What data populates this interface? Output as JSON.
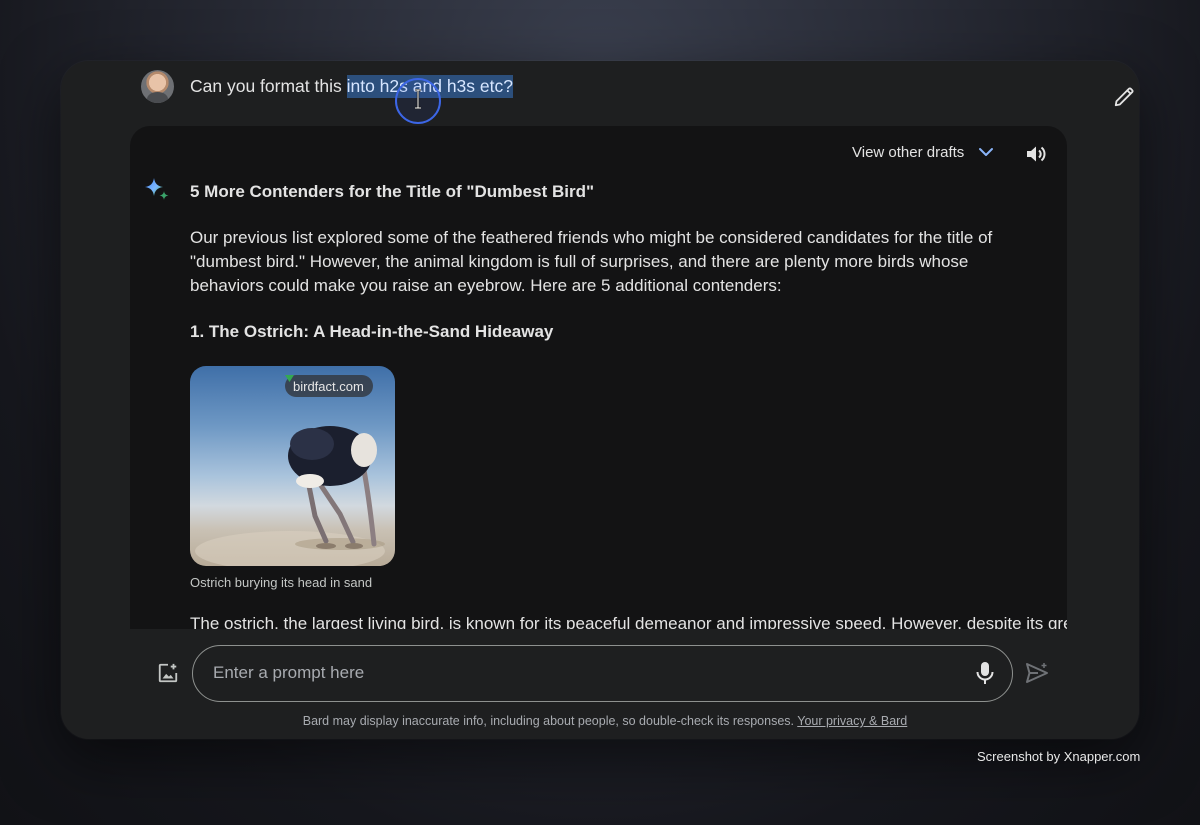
{
  "user_message": {
    "text_before": "Can you format this ",
    "text_selected": "into h2s and h3s etc?"
  },
  "response": {
    "drafts_label": "View other drafts",
    "title": "5 More Contenders for the Title of \"Dumbest Bird\"",
    "intro": "Our previous list explored some of the feathered friends who might be considered candidates for the title of \"dumbest bird.\" However, the animal kingdom is full of surprises, and there are plenty more birds whose behaviors could make you raise an eyebrow. Here are 5 additional contenders:",
    "section_heading": "1. The Ostrich: A Head-in-the-Sand Hideaway",
    "image": {
      "source": "birdfact.com",
      "caption": "Ostrich burying its head in sand"
    },
    "cutoff_text": "The ostrich, the largest living bird, is known for its peaceful demeanor and impressive speed. However, despite its great"
  },
  "composer": {
    "placeholder": "Enter a prompt here"
  },
  "footer": {
    "disclaimer": "Bard may display inaccurate info, including about people, so double-check its responses.",
    "privacy_link": "Your privacy & Bard"
  },
  "credit": "Screenshot by Xnapper.com",
  "colors": {
    "window_bg": "#1e1f20",
    "response_bg": "#131314",
    "selection": "#2c4f7c",
    "cursor_ring": "#3c66e6",
    "text": "#e3e3e3"
  },
  "icons": [
    "pencil-icon",
    "chevron-down-icon",
    "speaker-icon",
    "sparkle-icon",
    "add-image-icon",
    "mic-icon",
    "send-icon"
  ]
}
